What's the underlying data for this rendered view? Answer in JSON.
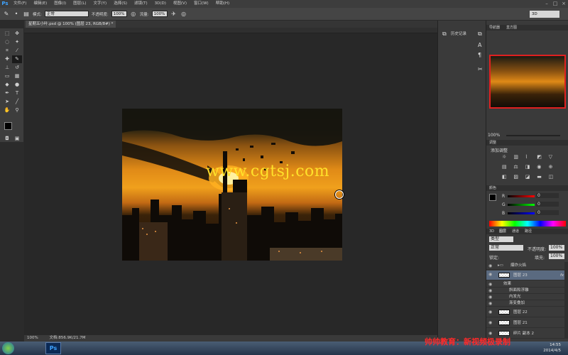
{
  "menubar": {
    "logo": "Ps",
    "items": [
      "文件(F)",
      "编辑(E)",
      "图像(I)",
      "图层(L)",
      "文字(Y)",
      "选择(S)",
      "滤镜(T)",
      "3D(D)",
      "视图(V)",
      "窗口(W)",
      "帮助(H)"
    ],
    "window_controls": [
      "–",
      "□",
      "×"
    ]
  },
  "options": {
    "mode_label": "模式:",
    "mode_value": "正常",
    "opacity_label": "不透明度:",
    "opacity_value": "100%",
    "flow_label": "流量:",
    "flow_value": "100%",
    "workspace_value": "3D"
  },
  "document": {
    "tab_title": "星期五小叶.psd @ 100% (图层 23, RGB/8#) *",
    "zoom": "100%",
    "doc_size": "文档:856.9K/21.7M"
  },
  "image": {
    "text_overlay": "www.cgtsj.com",
    "colors": {
      "sky_bright": "#f0a01c",
      "sky_dark": "#1c1a13",
      "text": "#ffe12a"
    }
  },
  "narrow_panel": {
    "history_label": "历史记录"
  },
  "navigator": {
    "tab_navigator": "导航器",
    "tab_histogram": "直方图",
    "zoom": "100%"
  },
  "adjustments": {
    "tab": "调整",
    "add_label": "添加调整"
  },
  "color_panel": {
    "tab": "颜色",
    "r_label": "R",
    "r_value": "0",
    "g_label": "G",
    "g_value": "0",
    "b_label": "B",
    "b_value": "0"
  },
  "layers_panel": {
    "tabs": [
      "3D",
      "图层",
      "通道",
      "路径"
    ],
    "kind_label": "类型",
    "blend_mode": "正常",
    "opacity_label": "不透明度:",
    "opacity_value": "100%",
    "lock_label": "锁定:",
    "fill_label": "填充:",
    "fill_value": "100%",
    "layers": [
      {
        "name": "爆炸火焰",
        "type": "group"
      },
      {
        "name": "图层 23",
        "type": "layer",
        "fx": "fx"
      },
      {
        "name": "效果",
        "type": "effect-head"
      },
      {
        "name": "斜面和浮雕",
        "type": "effect"
      },
      {
        "name": "内发光",
        "type": "effect"
      },
      {
        "name": "渐变叠加",
        "type": "effect"
      },
      {
        "name": "图层 22",
        "type": "layer"
      },
      {
        "name": "图层 21",
        "type": "layer"
      },
      {
        "name": "碎片 副本 2",
        "type": "layer"
      }
    ]
  },
  "taskbar": {
    "ps_label": "Ps",
    "time": "14:55",
    "date": "2014/4/5"
  },
  "watermark": "帅帅教育：新视频极录制"
}
